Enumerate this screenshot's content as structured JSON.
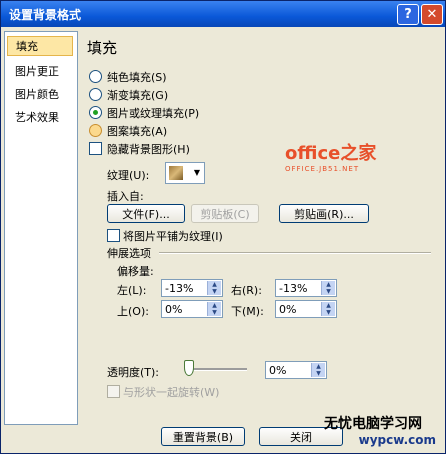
{
  "title": "设置背景格式",
  "title_buttons": {
    "help": "?",
    "close": "✕"
  },
  "sidebar": {
    "items": [
      {
        "label": "填充"
      },
      {
        "label": "图片更正"
      },
      {
        "label": "图片颜色"
      },
      {
        "label": "艺术效果"
      }
    ]
  },
  "section_title": "填充",
  "fill_options": [
    {
      "label": "纯色填充(S)"
    },
    {
      "label": "渐变填充(G)"
    },
    {
      "label": "图片或纹理填充(P)",
      "selected": true
    },
    {
      "label": "图案填充(A)"
    }
  ],
  "hide_bg_label": "隐藏背景图形(H)",
  "texture_label": "纹理(U):",
  "insert_from_label": "插入自:",
  "buttons": {
    "file": "文件(F)...",
    "clipboard": "剪贴板(C)",
    "clipart": "剪贴画(R)..."
  },
  "tile_label": "将图片平铺为纹理(I)",
  "stretch_label": "伸展选项",
  "offset_label": "偏移量:",
  "offsets": {
    "left_label": "左(L):",
    "left_val": "-13%",
    "right_label": "右(R):",
    "right_val": "-13%",
    "top_label": "上(O):",
    "top_val": "0%",
    "bottom_label": "下(M):",
    "bottom_val": "0%"
  },
  "transparency_label": "透明度(T):",
  "transparency_val": "0%",
  "rotate_label": "与形状一起旋转(W)",
  "footer": {
    "reset": "重置背景(B)",
    "close": "关闭"
  },
  "logo": {
    "main": "office之家",
    "sub": "OFFICE.JB51.NET"
  },
  "watermark": {
    "main": "无忧电脑学习网",
    "sub": "wypcw.com"
  }
}
